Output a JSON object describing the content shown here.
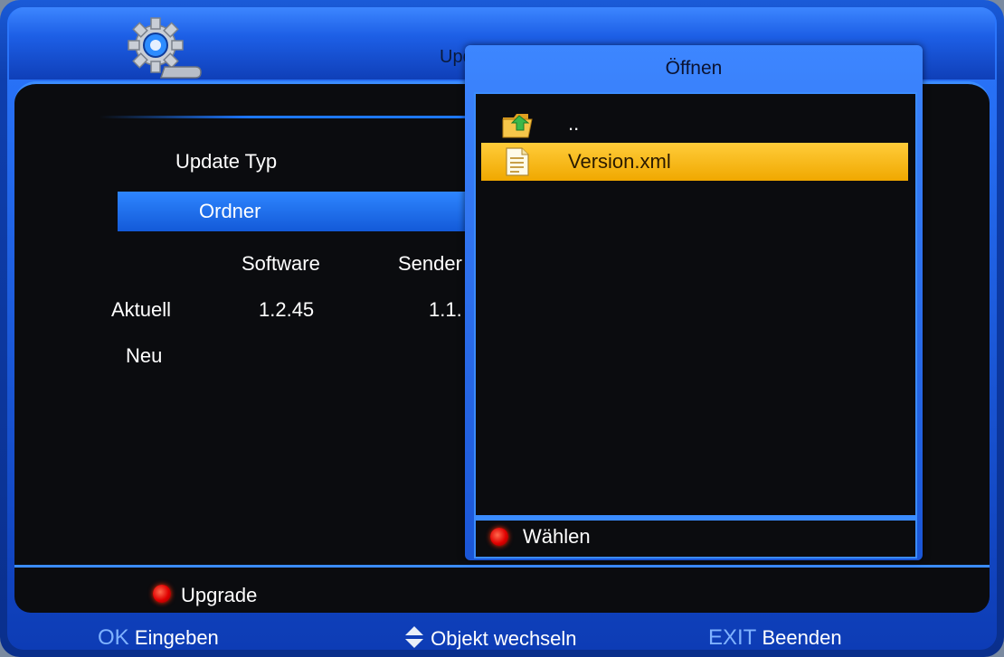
{
  "window": {
    "title": "Update"
  },
  "settings": {
    "update_type_label": "Update Typ",
    "selected_option": "Ordner",
    "columns": [
      "Software",
      "Sender"
    ],
    "rows": [
      {
        "label": "Aktuell",
        "software": "1.2.45",
        "sender": "1.1."
      },
      {
        "label": "Neu",
        "software": "",
        "sender": ""
      }
    ]
  },
  "footer": {
    "red_action": "Upgrade"
  },
  "bottom_hints": [
    {
      "key": "OK",
      "label": "Eingeben"
    },
    {
      "key": "",
      "label": "Objekt wechseln",
      "icon": "up-down-arrows-icon"
    },
    {
      "key": "EXIT",
      "label": "Beenden"
    }
  ],
  "dialog": {
    "title": "Öffnen",
    "items": [
      {
        "name": "..",
        "icon": "folder-up-icon",
        "selected": false
      },
      {
        "name": "Version.xml",
        "icon": "document-icon",
        "selected": true
      }
    ],
    "red_action": "Wählen"
  },
  "colors": {
    "accent": "#1e78ff",
    "selection": "#f0a800",
    "red_button": "#e00000"
  }
}
